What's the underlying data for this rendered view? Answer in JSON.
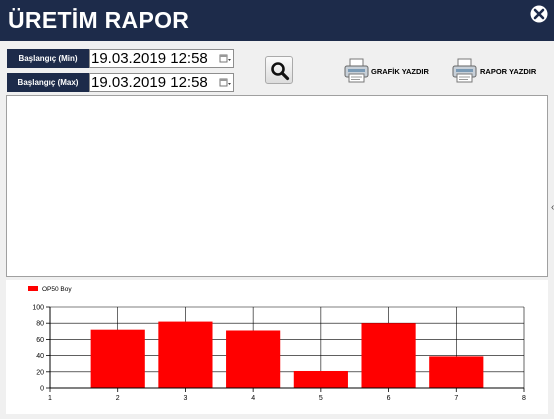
{
  "window": {
    "title": "ÜRETİM RAPOR"
  },
  "filters": {
    "start_min_label": "Başlangıç (Min)",
    "start_min_value": "19.03.2019 12:58",
    "start_max_label": "Başlangıç (Max)",
    "start_max_value": "19.03.2019 12:58"
  },
  "toolbar": {
    "print_chart_label": "GRAFİK YAZDIR",
    "print_report_label": "RAPOR YAZDIR"
  },
  "colors": {
    "header": "#1d2b4a",
    "series": "#ff0000"
  },
  "chart_data": {
    "type": "bar",
    "legend": "OP50 Boy",
    "legend_position": "top-left",
    "x": [
      2,
      3,
      4,
      5,
      6,
      7
    ],
    "values": [
      72,
      82,
      71,
      21,
      80,
      39
    ],
    "xlim": [
      1,
      8
    ],
    "ylim": [
      0,
      100
    ],
    "x_ticks": [
      1,
      2,
      3,
      4,
      5,
      6,
      7,
      8
    ],
    "y_ticks": [
      0,
      20,
      40,
      60,
      80,
      100
    ],
    "grid": true
  }
}
